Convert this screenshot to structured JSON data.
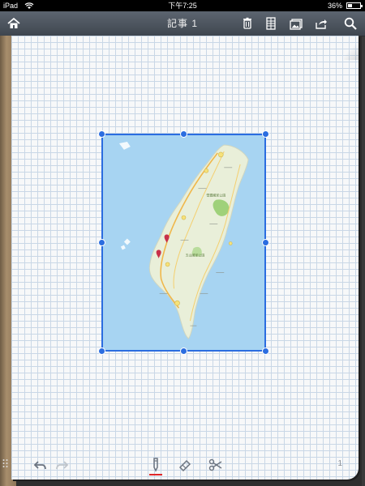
{
  "status_bar": {
    "carrier": "iPad",
    "time": "下午7:25",
    "battery": "36%",
    "battery_level": 0.36
  },
  "toolbar": {
    "title": "記事 1",
    "left_icons": [
      "home-icon"
    ],
    "right_icons": [
      "trash-icon",
      "document-grid-icon",
      "gallery-icon",
      "share-icon",
      "search-icon"
    ]
  },
  "note": {
    "image": {
      "kind": "map",
      "subject": "Taiwan",
      "selected": true
    },
    "map_labels": [
      "雪霸國家公園",
      "玉山國家公園"
    ]
  },
  "bottom_bar": {
    "tools": [
      "undo-icon",
      "redo-icon",
      "pen-icon",
      "eraser-icon",
      "scissors-icon"
    ],
    "active_tool": "pen-icon",
    "page_number": "1"
  },
  "colors": {
    "selection": "#2b6de0",
    "grid": "#c9d7e6",
    "pen_accent": "#e0282a",
    "toolbar": "#4d555f"
  }
}
